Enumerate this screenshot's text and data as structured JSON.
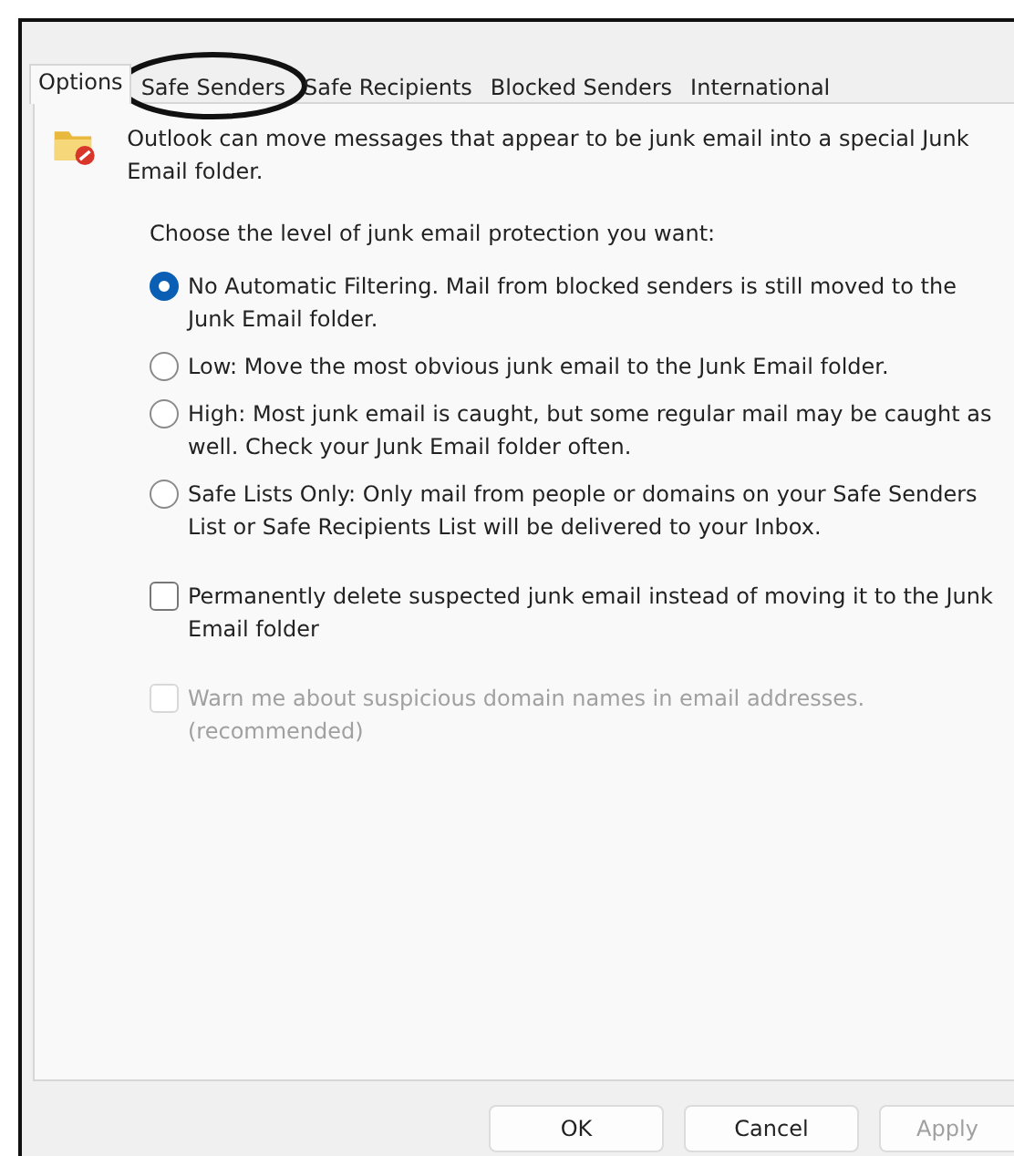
{
  "tabs": [
    {
      "label": "Options",
      "selected": true,
      "circled": false
    },
    {
      "label": "Safe Senders",
      "selected": false,
      "circled": true
    },
    {
      "label": "Safe Recipients",
      "selected": false,
      "circled": false
    },
    {
      "label": "Blocked Senders",
      "selected": false,
      "circled": false
    },
    {
      "label": "International",
      "selected": false,
      "circled": false
    }
  ],
  "intro": "Outlook can move messages that appear to be junk email into a special Junk Email folder.",
  "prompt": "Choose the level of junk email protection you want:",
  "levels": [
    {
      "label": "No Automatic Filtering. Mail from blocked senders is still moved to the Junk Email folder.",
      "selected": true
    },
    {
      "label": "Low: Move the most obvious junk email to the Junk Email folder.",
      "selected": false
    },
    {
      "label": "High: Most junk email is caught, but some regular mail may be caught as well. Check your Junk Email folder often.",
      "selected": false
    },
    {
      "label": "Safe Lists Only: Only mail from people or domains on your Safe Senders List or Safe Recipients List will be delivered to your Inbox.",
      "selected": false
    }
  ],
  "options": [
    {
      "label": "Permanently delete suspected junk email instead of moving it to the Junk Email folder",
      "checked": false,
      "disabled": false
    },
    {
      "label": "Warn me about suspicious domain names in email addresses. (recommended)",
      "checked": false,
      "disabled": true
    }
  ],
  "buttons": [
    {
      "label": "OK",
      "disabled": false
    },
    {
      "label": "Cancel",
      "disabled": false
    },
    {
      "label": "Apply",
      "disabled": true
    }
  ]
}
